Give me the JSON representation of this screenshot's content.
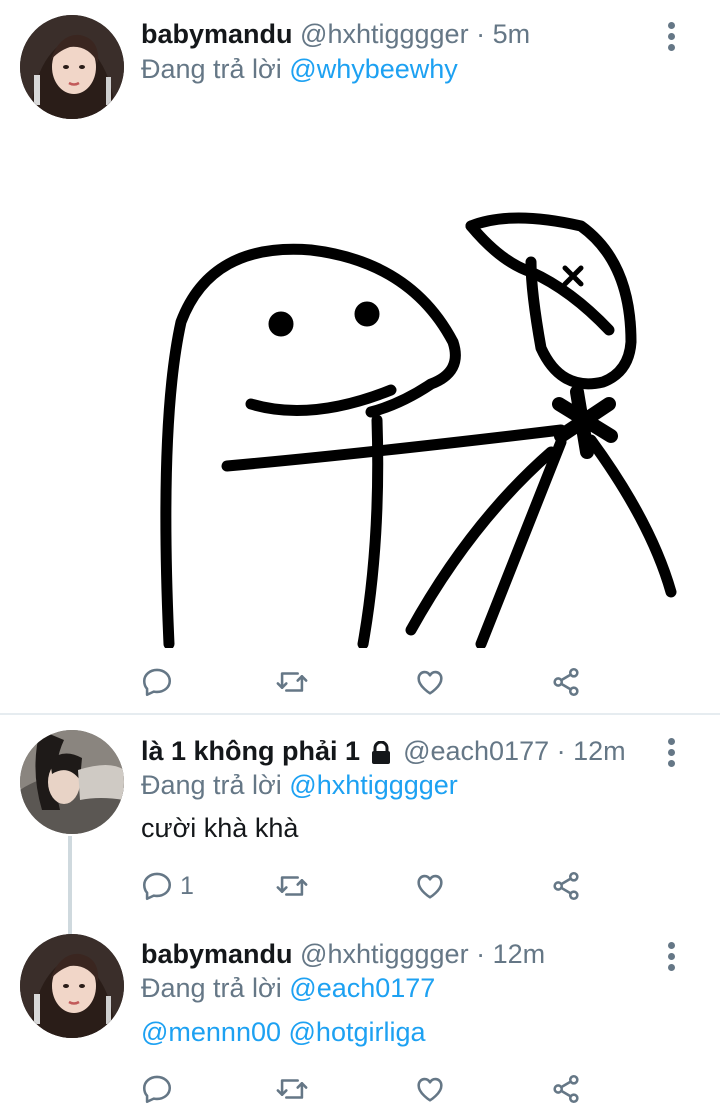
{
  "tweets": [
    {
      "name": "babymandu",
      "handle": "@hxhtigggger",
      "separator": "·",
      "time": "5m",
      "reply_prefix": "Đang trả lời",
      "reply_to": "@whybeewhy",
      "has_media": true,
      "actions": {
        "reply_count": "",
        "retweet_count": "",
        "like_count": ""
      }
    },
    {
      "name": "là 1 không phải 1",
      "protected": true,
      "handle": "@each0177",
      "separator": "·",
      "time": "12m",
      "reply_prefix": "Đang trả lời",
      "reply_to": "@hxhtigggger",
      "text": "cười khà khà",
      "actions": {
        "reply_count": "1",
        "retweet_count": "",
        "like_count": ""
      }
    },
    {
      "name": "babymandu",
      "handle": "@hxhtigggger",
      "separator": "·",
      "time": "12m",
      "reply_prefix": "Đang trả lời",
      "reply_to": "@each0177",
      "mentions": [
        "@mennn00",
        "@hotgirliga"
      ],
      "actions": {
        "reply_count": "",
        "retweet_count": "",
        "like_count": ""
      }
    }
  ],
  "icons": [
    "more-icon",
    "reply-icon",
    "retweet-icon",
    "like-icon",
    "share-icon",
    "lock-icon"
  ],
  "colors": {
    "link": "#1da1f2",
    "secondary": "#657786",
    "primary_text": "#14171a",
    "divider": "#e6ecf0"
  }
}
